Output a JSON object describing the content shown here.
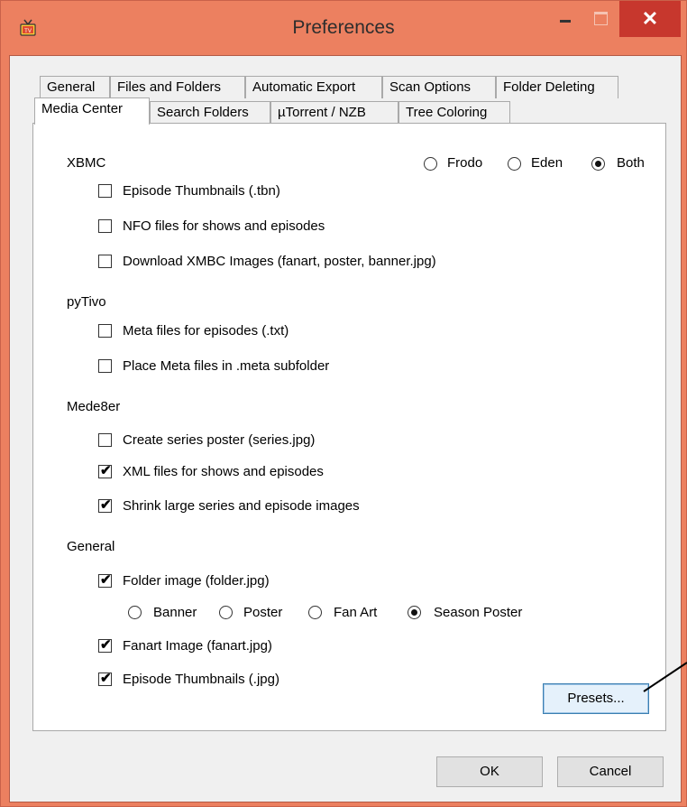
{
  "window": {
    "title": "Preferences",
    "app_icon": "tv-icon",
    "controls": {
      "minimize": "minimize-icon",
      "maximize": "maximize-icon",
      "close": "✕"
    },
    "frame_color": "#ec8060",
    "close_color": "#c7372d"
  },
  "tabs": {
    "row1": [
      "General",
      "Files and Folders",
      "Automatic Export",
      "Scan Options",
      "Folder Deleting"
    ],
    "row2": [
      "Media Center",
      "Search Folders",
      "µTorrent / NZB",
      "Tree Coloring"
    ],
    "active": "Media Center"
  },
  "xbmc": {
    "heading": "XBMC",
    "version_options": [
      {
        "label": "Frodo",
        "selected": false
      },
      {
        "label": "Eden",
        "selected": false
      },
      {
        "label": "Both",
        "selected": true
      }
    ],
    "checkboxes": [
      {
        "label": "Episode Thumbnails (.tbn)",
        "checked": false
      },
      {
        "label": "NFO files for shows and episodes",
        "checked": false
      },
      {
        "label": "Download XMBC Images (fanart, poster, banner.jpg)",
        "checked": false
      }
    ]
  },
  "pytivo": {
    "heading": "pyTivo",
    "checkboxes": [
      {
        "label": "Meta files for episodes (.txt)",
        "checked": false
      },
      {
        "label": "Place Meta files in .meta subfolder",
        "checked": false
      }
    ]
  },
  "mede8er": {
    "heading": "Mede8er",
    "checkboxes": [
      {
        "label": "Create series poster (series.jpg)",
        "checked": false
      },
      {
        "label": "XML files for shows and episodes",
        "checked": true
      },
      {
        "label": "Shrink large series and episode images",
        "checked": true
      }
    ]
  },
  "general": {
    "heading": "General",
    "folder_image": {
      "label": "Folder image (folder.jpg)",
      "checked": true
    },
    "folder_image_options": [
      {
        "label": "Banner",
        "selected": false
      },
      {
        "label": "Poster",
        "selected": false
      },
      {
        "label": "Fan Art",
        "selected": false
      },
      {
        "label": "Season Poster",
        "selected": true
      }
    ],
    "fanart": {
      "label": "Fanart Image (fanart.jpg)",
      "checked": true
    },
    "episode_thumbs": {
      "label": "Episode Thumbnails (.jpg)",
      "checked": true
    }
  },
  "buttons": {
    "presets": "Presets...",
    "ok": "OK",
    "cancel": "Cancel"
  },
  "check_mark": "✔"
}
